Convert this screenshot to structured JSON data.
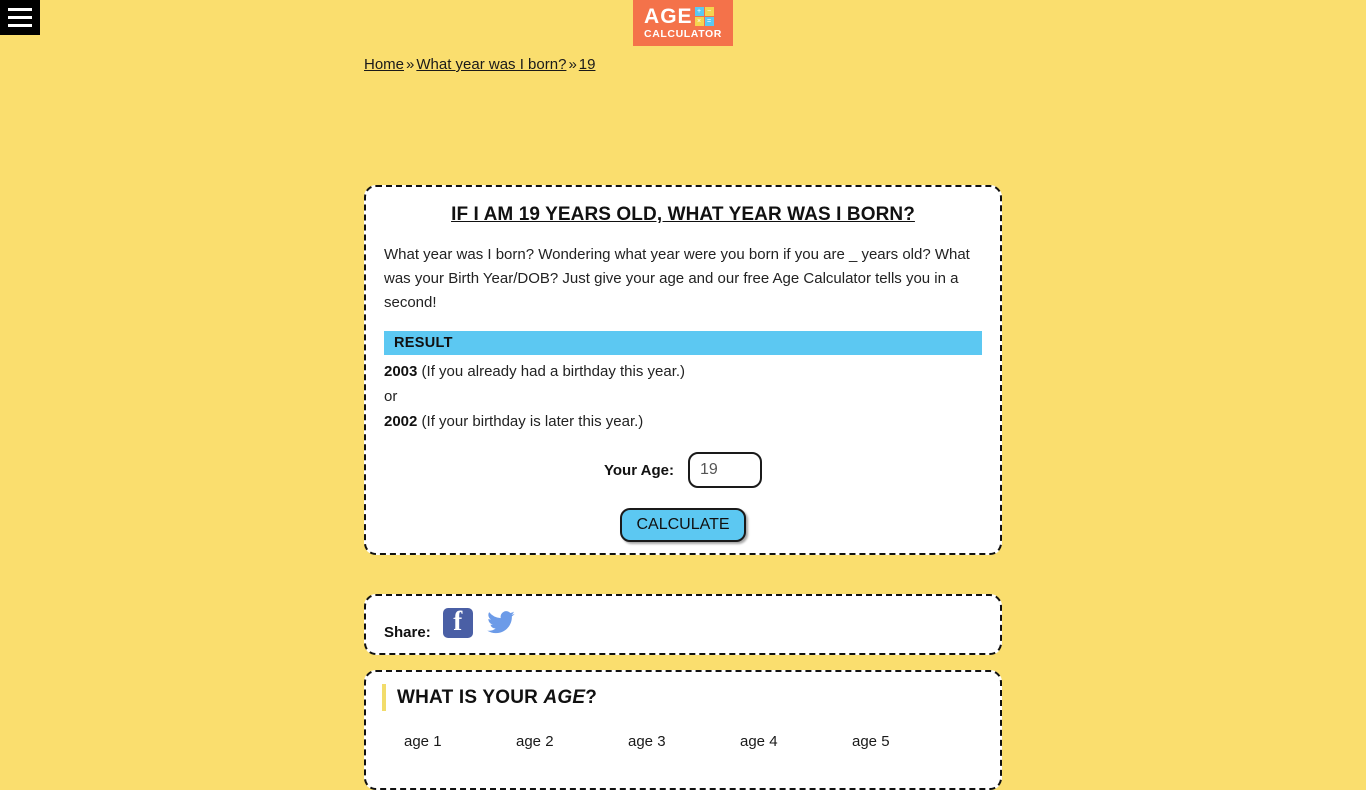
{
  "menu": {
    "icon": "hamburger-menu-icon",
    "label": "Menu"
  },
  "logo": {
    "title": "AGE",
    "subtitle": "CALCULATOR",
    "keys": [
      "+",
      "−",
      "×",
      "="
    ],
    "background": "#f4724a"
  },
  "breadcrumb": {
    "items": [
      {
        "label": "Home"
      },
      {
        "label": "What year was I born?"
      },
      {
        "label": "19"
      }
    ],
    "separator": "»"
  },
  "main": {
    "title": "IF I AM 19 YEARS OLD, WHAT YEAR WAS I BORN?",
    "description": "What year was I born? Wondering what year were you born if you are _ years old? What was your Birth Year/DOB? Just give your age and our free Age Calculator tells you in a second!",
    "result_header": "RESULT",
    "result_primary_year": "2003",
    "result_primary_note": "(If you already had a birthday this year.)",
    "result_conjunction": "or",
    "result_secondary_year": "2002",
    "result_secondary_note": "(If your birthday is later this year.)",
    "age_label": "Your Age:",
    "age_value": "19",
    "age_placeholder": "19",
    "calculate_label": "CALCULATE",
    "accent_color": "#5cc8f2"
  },
  "share": {
    "label": "Share:",
    "facebook_icon": "facebook-icon",
    "twitter_icon": "twitter-icon",
    "facebook_color": "#4a5fa5",
    "twitter_color": "#6c9be8"
  },
  "age_section": {
    "title_prefix": "WHAT IS YOUR ",
    "title_emphasis": "AGE",
    "title_suffix": "?",
    "links": [
      "age 1",
      "age 2",
      "age 3",
      "age 4",
      "age 5"
    ],
    "accent_color": "#f2dc6b"
  },
  "page": {
    "background": "#fade6e"
  }
}
